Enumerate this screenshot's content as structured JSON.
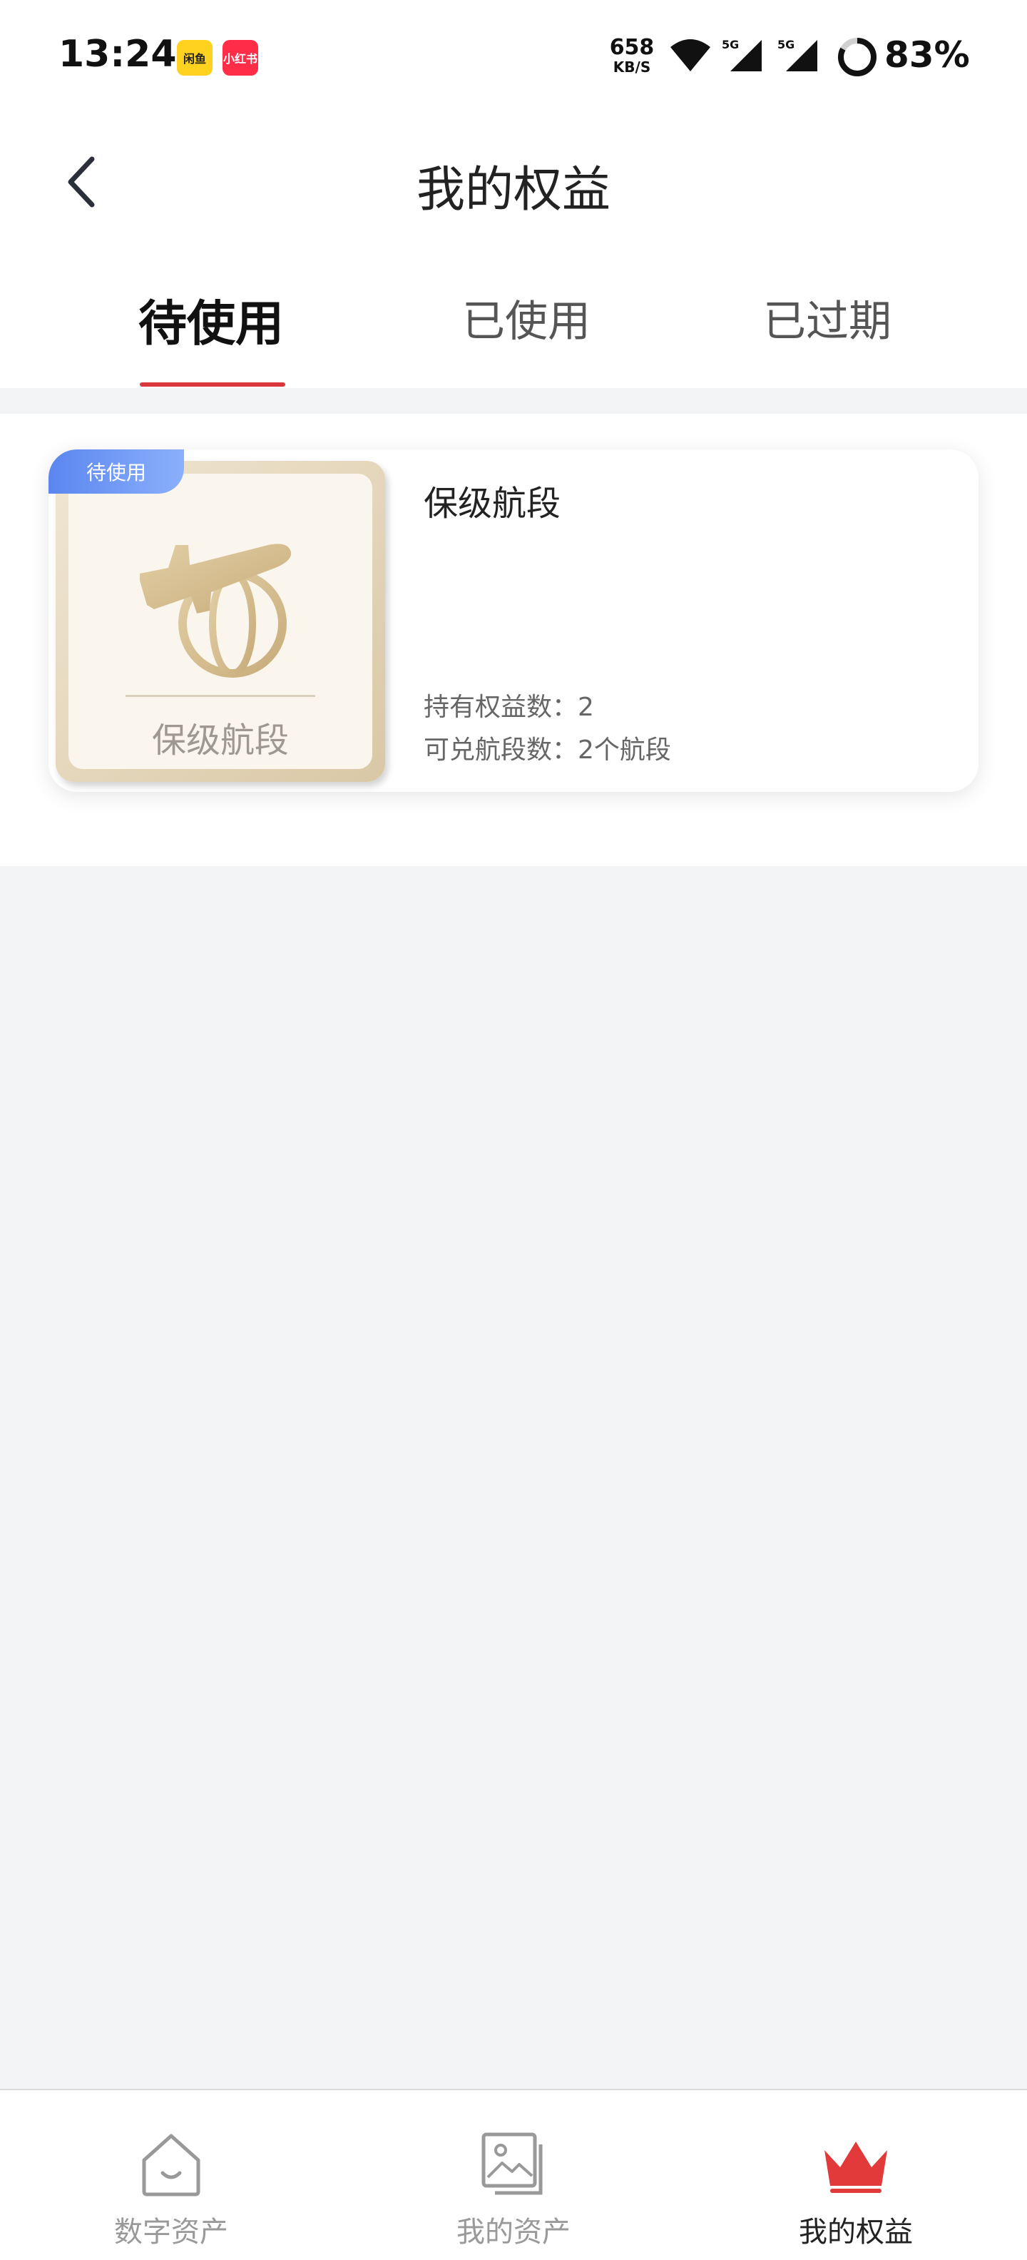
{
  "status_bar": {
    "time": "13:24",
    "app_badges": [
      "闲鱼",
      "小红书"
    ],
    "net_speed_value": "658",
    "net_speed_unit": "KB/S",
    "signal_labels": [
      "5G",
      "5G"
    ],
    "battery": "83%",
    "battery_level": 0.83
  },
  "header": {
    "title": "我的权益",
    "back_icon": "chevron-left-icon"
  },
  "tabs": [
    {
      "label": "待使用",
      "active": true
    },
    {
      "label": "已使用",
      "active": false
    },
    {
      "label": "已过期",
      "active": false
    }
  ],
  "cards": [
    {
      "tag": "待使用",
      "thumb_caption": "保级航段",
      "title": "保级航段",
      "lines": [
        "持有权益数：2",
        "可兑航段数：2个航段"
      ],
      "icon": "airplane-globe-icon"
    }
  ],
  "bottom_nav": [
    {
      "label": "数字资产",
      "icon": "home-icon",
      "active": false
    },
    {
      "label": "我的资产",
      "icon": "image-icon",
      "active": false
    },
    {
      "label": "我的权益",
      "icon": "crown-icon",
      "active": true
    }
  ],
  "colors": {
    "accent_red": "#d9363e",
    "tag_blue": "#5b86ef",
    "gold": "#d8c39a",
    "background": "#f3f4f6"
  }
}
